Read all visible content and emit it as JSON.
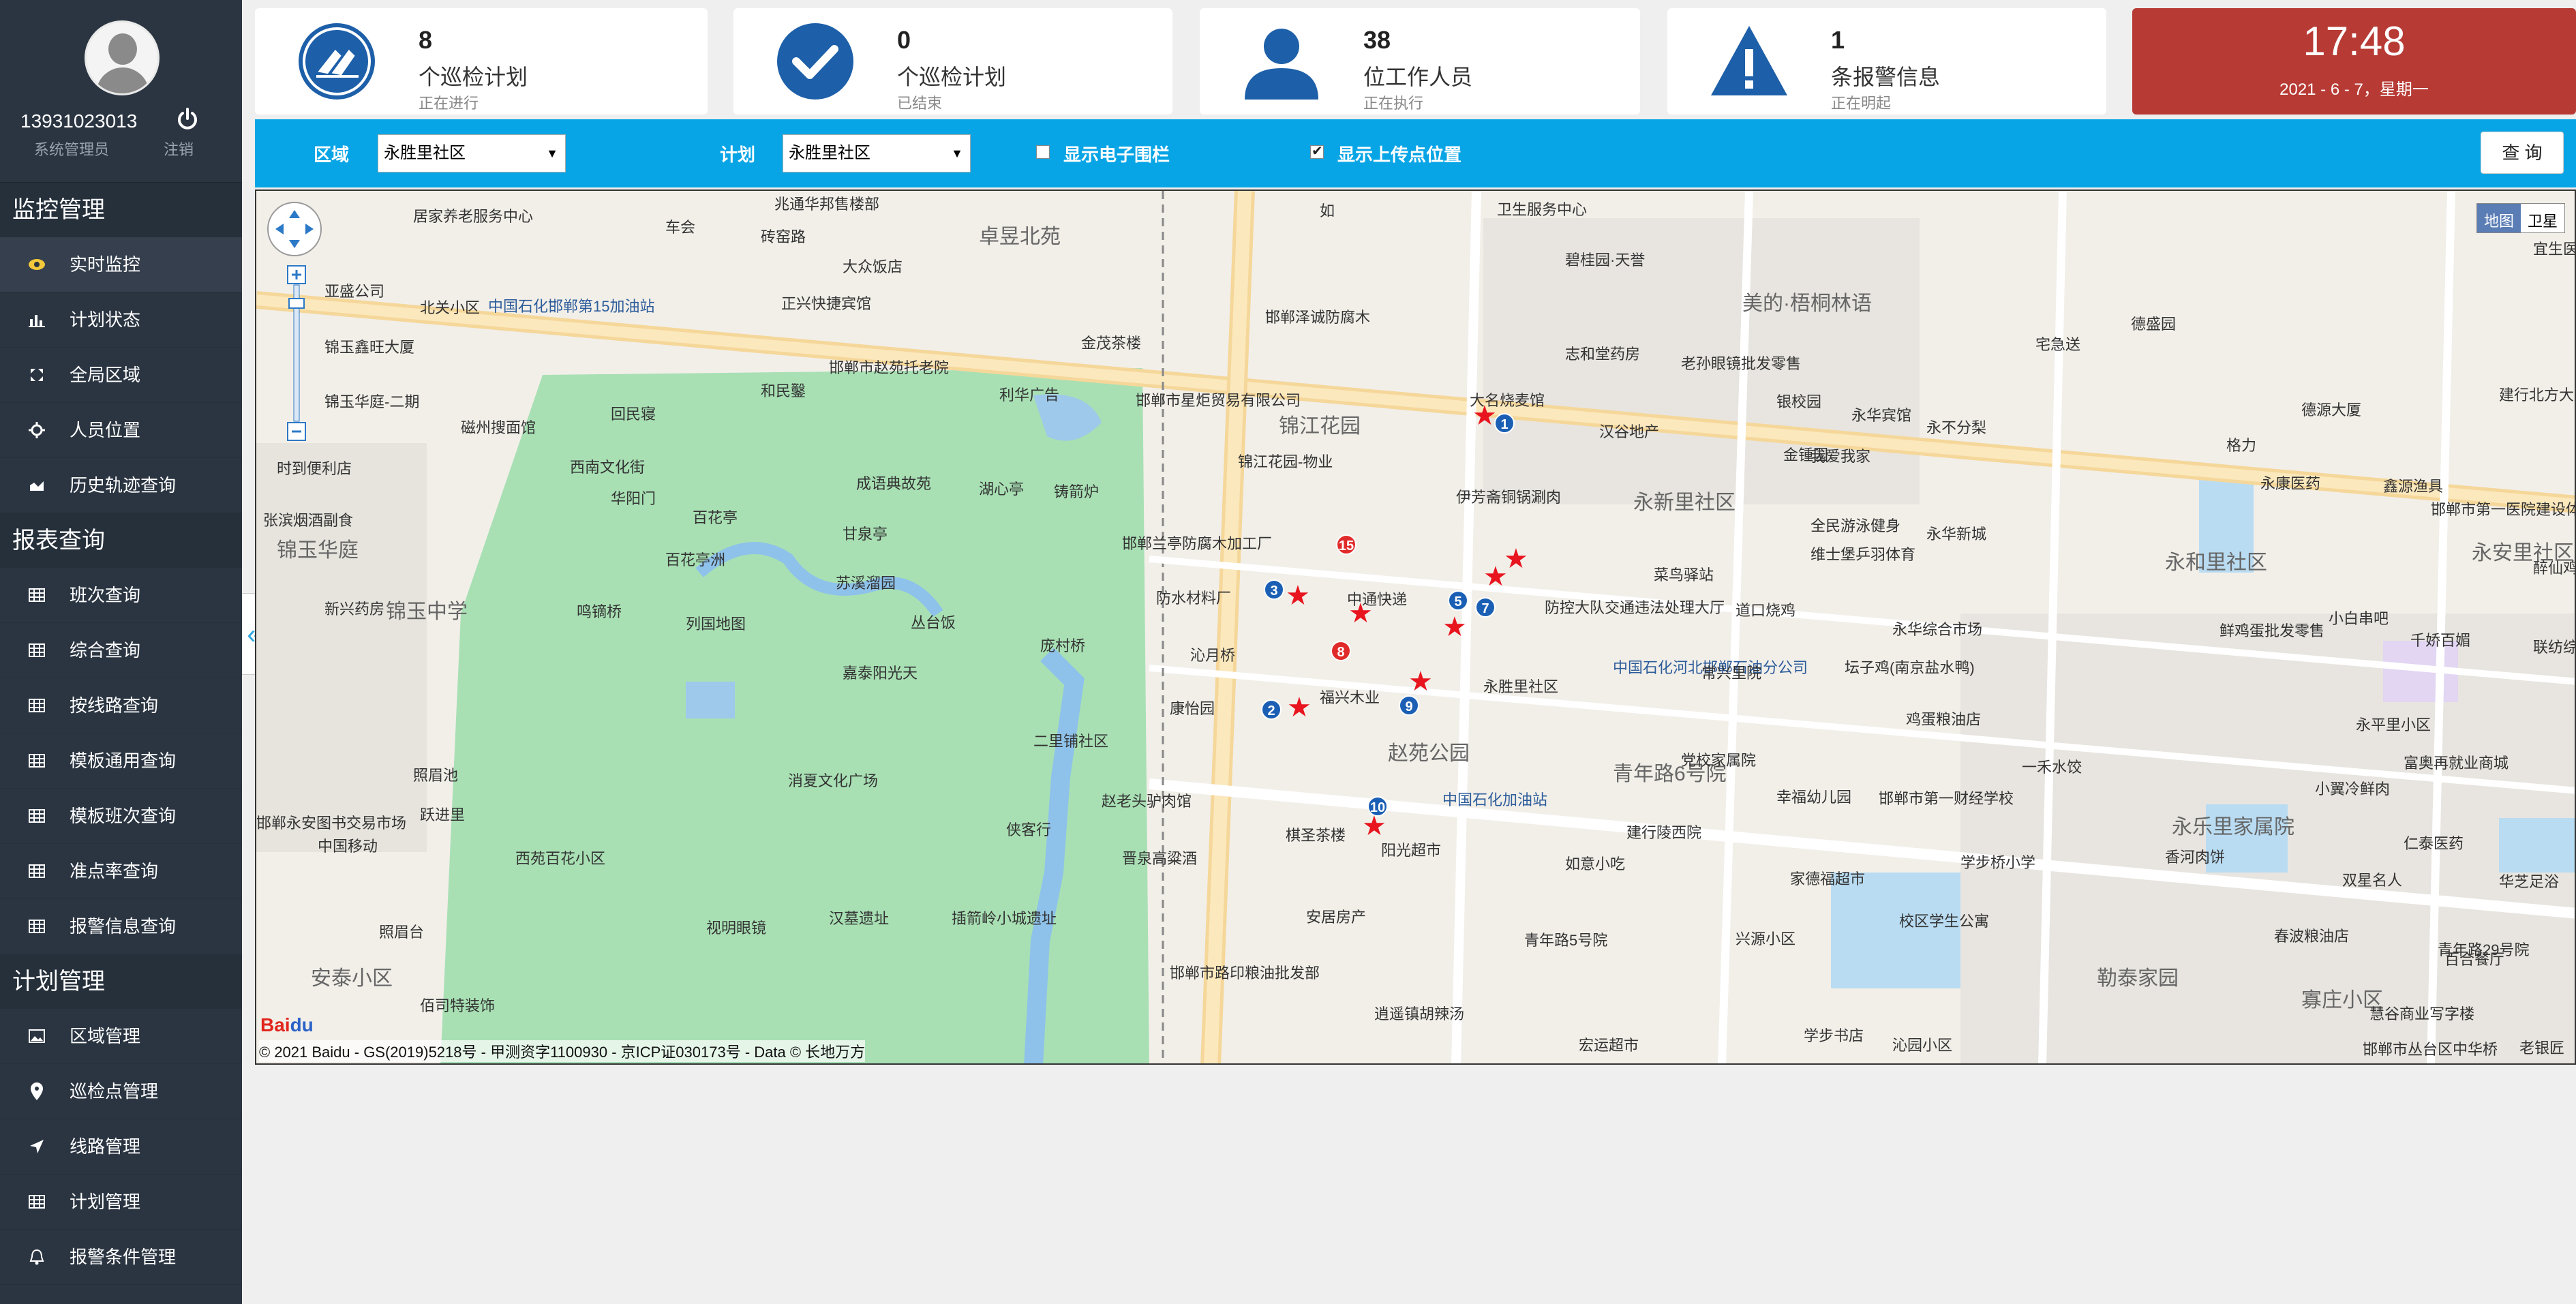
{
  "user": {
    "id": "13931023013",
    "role": "系统管理员",
    "logout": "注销"
  },
  "sidebar": {
    "sections": [
      {
        "title": "监控管理",
        "items": [
          {
            "label": "实时监控",
            "icon": "eye-icon",
            "active": true
          },
          {
            "label": "计划状态",
            "icon": "bar-chart-icon"
          },
          {
            "label": "全局区域",
            "icon": "expand-icon"
          },
          {
            "label": "人员位置",
            "icon": "crosshair-icon"
          },
          {
            "label": "历史轨迹查询",
            "icon": "area-chart-icon"
          }
        ]
      },
      {
        "title": "报表查询",
        "items": [
          {
            "label": "班次查询",
            "icon": "table-icon"
          },
          {
            "label": "综合查询",
            "icon": "table-icon"
          },
          {
            "label": "按线路查询",
            "icon": "table-icon"
          },
          {
            "label": "模板通用查询",
            "icon": "table-icon"
          },
          {
            "label": "模板班次查询",
            "icon": "table-icon"
          },
          {
            "label": "准点率查询",
            "icon": "table-icon"
          },
          {
            "label": "报警信息查询",
            "icon": "table-icon"
          }
        ]
      },
      {
        "title": "计划管理",
        "items": [
          {
            "label": "区域管理",
            "icon": "picture-icon"
          },
          {
            "label": "巡检点管理",
            "icon": "map-pin-icon"
          },
          {
            "label": "线路管理",
            "icon": "location-arrow-icon"
          },
          {
            "label": "计划管理",
            "icon": "table-icon"
          },
          {
            "label": "报警条件管理",
            "icon": "bell-icon"
          }
        ]
      }
    ]
  },
  "cards": [
    {
      "num": "8",
      "label": "个巡检计划",
      "sub": "正在进行",
      "icon": "patrol-logo-icon"
    },
    {
      "num": "0",
      "label": "个巡检计划",
      "sub": "已结束",
      "icon": "check-circle-icon"
    },
    {
      "num": "38",
      "label": "位工作人员",
      "sub": "正在执行",
      "icon": "user-icon"
    },
    {
      "num": "1",
      "label": "条报警信息",
      "sub": "正在明起",
      "icon": "warning-icon"
    }
  ],
  "clock": {
    "time": "17:48",
    "date": "2021 - 6 - 7，星期一"
  },
  "filter": {
    "area_label": "区域",
    "area_value": "永胜里社区",
    "plan_label": "计划",
    "plan_value": "永胜里社区",
    "fence_label": "显示电子围栏",
    "fence_checked": false,
    "upload_label": "显示上传点位置",
    "upload_checked": true,
    "query_label": "查 询"
  },
  "map": {
    "type_map": "地图",
    "type_satellite": "卫星",
    "copyright": "© 2021 Baidu - GS(2019)5218号 - 甲测资字1100930 - 京ICP证030173号 - Data © 长地万方",
    "labels": [
      "居家养老服务中心",
      "车会",
      "兆通华邦售楼部",
      "如",
      "卫生服务中心",
      "亚盛公司",
      "北关小区",
      "中国石化邯郸第15加油站",
      "正兴快捷宾馆",
      "大众饭店",
      "砖窑路",
      "卓昱北苑",
      "碧桂园·天誉",
      "美的·梧桐林语",
      "邯郸泽诚防腐木",
      "金茂茶楼",
      "锦玉鑫旺大厦",
      "邯郸市赵苑托老院",
      "和民鑿",
      "利华广告",
      "志和堂药房",
      "老孙眼镜批发零售",
      "宅急送",
      "德盛园",
      "锦玉华庭-二期",
      "回民寝",
      "邯郸市星炬贸易有限公司",
      "锦江花园",
      "大名烧麦馆",
      "汉谷地产",
      "银校园",
      "永华宾馆",
      "永不分梨",
      "德源大厦",
      "建行北方大厦家属院",
      "磁州搜面馆",
      "西南文化街",
      "成语典故苑",
      "湖心亭",
      "铸箭炉",
      "锦江花园-物业",
      "伊芳斋铜锅涮肉",
      "永新里社区",
      "金锺园",
      "我爱我家",
      "格力",
      "永康医药",
      "鑫源渔具",
      "邯郸市第一医院建设体检科",
      "时到便利店",
      "华阳门",
      "百花亭",
      "甘泉亭",
      "永安里社区",
      "张滨烟酒副食",
      "锦玉华庭",
      "百花亭洲",
      "苏溪溜园",
      "邯郸兰亭防腐木加工厂",
      "防水材料厂",
      "中通快递",
      "防控大队交通违法处理大厅",
      "全民游泳健身",
      "永华新城",
      "维士堡乒羽体育",
      "菜鸟驿站",
      "道口烧鸡",
      "永华综合市场",
      "永和里社区",
      "醉仙鸡醉仙鸭",
      "新兴药房",
      "锦玉中学",
      "鸣镝桥",
      "列国地图",
      "丛台饭",
      "庞村桥",
      "沁月桥",
      "中国石化河北邯郸石油分公司",
      "常兴里院",
      "鲜鸡蛋批发零售",
      "小白串吧",
      "千娇百媚",
      "联纺综合市场",
      "嘉泰阳光天",
      "康怡园",
      "福兴木业",
      "永胜里社区",
      "坛子鸡(南京盐水鸭)",
      "鸡蛋粮油店",
      "二里铺社区",
      "照眉池",
      "消夏文化广场",
      "赵苑公园",
      "青年路6号院",
      "党校家属院",
      "一禾水饺",
      "永平里小区",
      "富奥再就业商城",
      "跃进里",
      "赵老头驴肉馆",
      "中国石化加油站",
      "幸福幼儿园",
      "邯郸市第一财经学校",
      "小翼冷鲜肉",
      "永乐里家属院",
      "邯郸永安图书交易市场",
      "中国移动",
      "西苑百花小区",
      "侠客行",
      "晋泉高粱酒",
      "棋圣茶楼",
      "阳光超市",
      "建行陵西院",
      "如意小吃",
      "家德福超市",
      "学步桥小学",
      "香河肉饼",
      "仁泰医药",
      "双星名人",
      "华芝足浴",
      "视明眼镜",
      "汉墓遗址",
      "插箭岭小城遗址",
      "照眉台",
      "安居房产",
      "青年路5号院",
      "兴源小区",
      "校区学生公寓",
      "春波粮油店",
      "青年路29号院",
      "百合餐厅",
      "安泰小区",
      "佰司特装饰",
      "逍遥镇胡辣汤",
      "宏运超市",
      "学步书店",
      "沁园小区",
      "勒泰家园",
      "寡庄小区",
      "慧谷商业写字楼",
      "邯郸市丛台区中华桥",
      "老银匠",
      "邯郸市路印粮油批发部",
      "宜生医"
    ]
  }
}
